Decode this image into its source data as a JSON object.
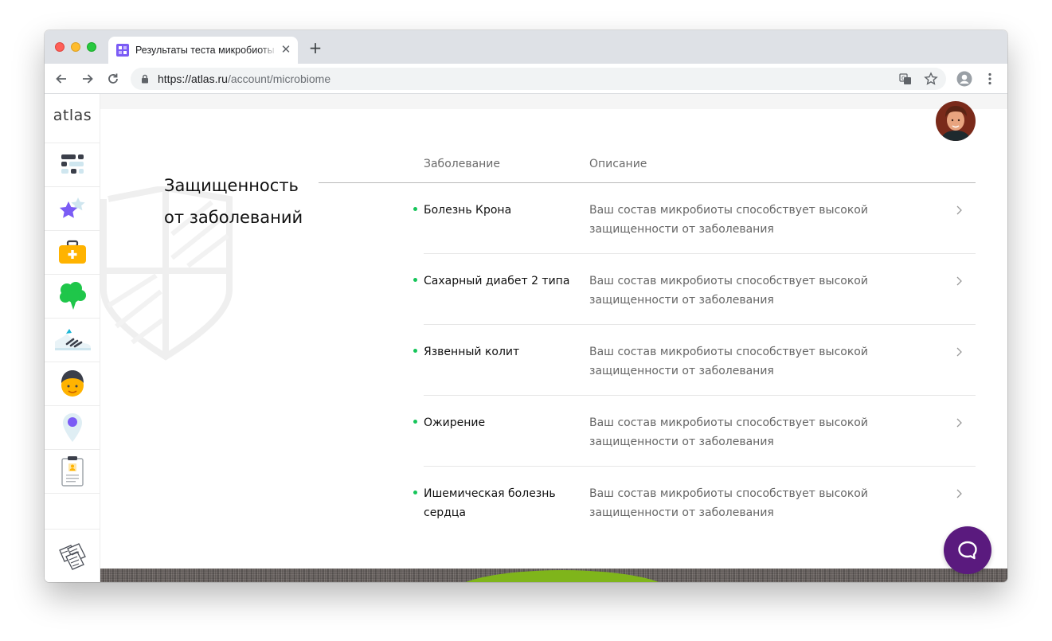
{
  "browser": {
    "tab_title": "Результаты теста микробиоты",
    "tab_close": "✕",
    "new_tab": "+",
    "url_host": "https://atlas.ru",
    "url_path": "/account/microbiome"
  },
  "sidebar": {
    "logo": "atlas",
    "items": [
      {
        "icon": "dashboard-icon"
      },
      {
        "icon": "stars-icon"
      },
      {
        "icon": "medical-kit-icon"
      },
      {
        "icon": "broccoli-icon"
      },
      {
        "icon": "sneaker-icon"
      },
      {
        "icon": "person-icon"
      },
      {
        "icon": "location-pin-icon"
      },
      {
        "icon": "clipboard-badge-icon"
      }
    ],
    "bottom_icon": "documents-icon"
  },
  "section": {
    "title_line1": "Защищенность",
    "title_line2": "от заболеваний"
  },
  "table": {
    "col_disease": "Заболевание",
    "col_description": "Описание",
    "rows": [
      {
        "name": "Болезнь Крона",
        "desc": "Ваш состав микробиоты способствует высокой защищенности от заболевания"
      },
      {
        "name": "Сахарный диабет 2 типа",
        "desc": "Ваш состав микробиоты способствует высокой защищенности от заболевания"
      },
      {
        "name": "Язвенный колит",
        "desc": "Ваш состав микробиоты способствует высокой защищенности от заболевания"
      },
      {
        "name": "Ожирение",
        "desc": "Ваш состав микробиоты способствует высокой защищенности от заболевания"
      },
      {
        "name": "Ишемическая болезнь сердца",
        "desc": "Ваш состав микробиоты способствует высокой защищенности от заболевания"
      }
    ]
  },
  "colors": {
    "accent_green": "#16c55a",
    "chat_purple": "#5a1a7e"
  }
}
